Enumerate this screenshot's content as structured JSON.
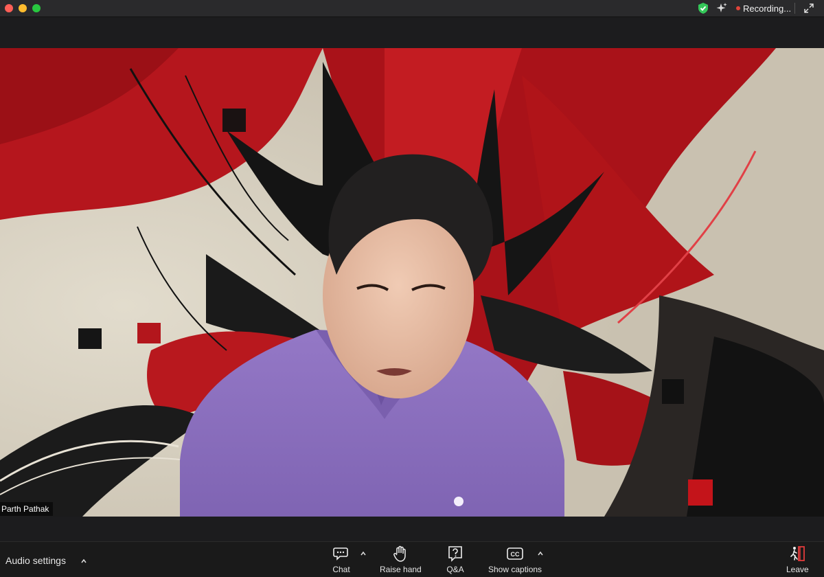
{
  "window": {
    "recording_label": "Recording...",
    "status_icons": [
      "shield-check-icon",
      "sparkle-icon",
      "expand-icon"
    ]
  },
  "video": {
    "participant_name": "Parth Pathak",
    "name_tag_display": "Parth Pathak"
  },
  "toolbar": {
    "audio_settings": "Audio settings",
    "chat": "Chat",
    "raise_hand": "Raise hand",
    "qa": "Q&A",
    "show_captions": "Show captions",
    "leave": "Leave"
  },
  "colors": {
    "recording_dot": "#e0443a",
    "shield": "#34c759",
    "shirt": "#8e6fbf",
    "background_red": "#b3161c",
    "toolbar_bg": "#1a1a1a"
  }
}
